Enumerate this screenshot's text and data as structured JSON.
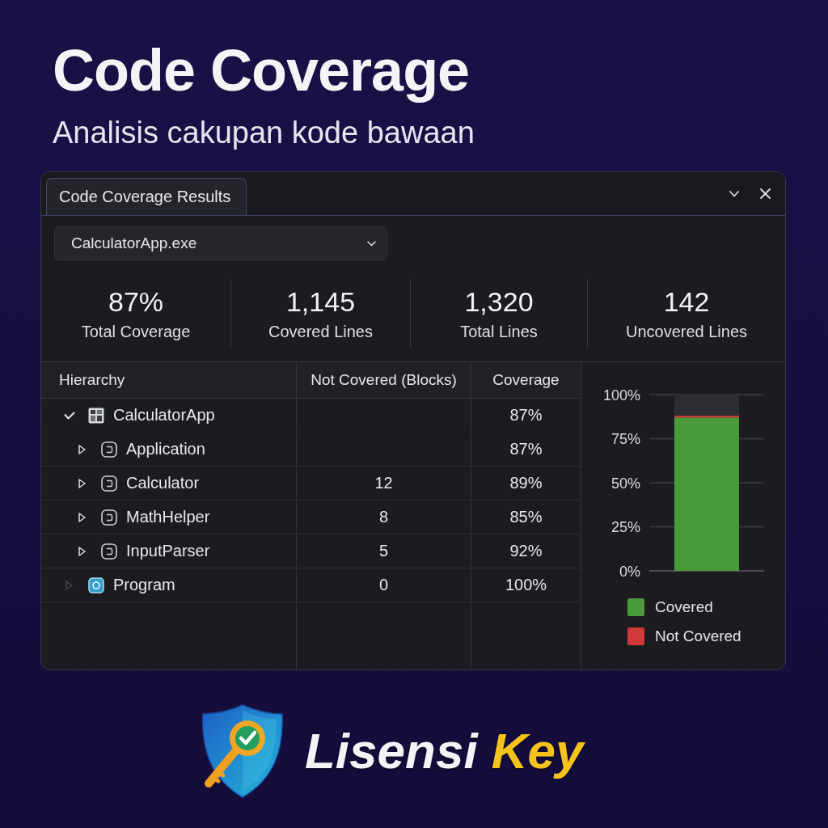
{
  "header": {
    "title": "Code Coverage",
    "subtitle": "Analisis cakupan kode bawaan"
  },
  "window": {
    "tabs": [
      {
        "label": "Code Coverage Results",
        "selected": true
      }
    ],
    "target_selector": {
      "value": "CalculatorApp.exe"
    },
    "stats": [
      {
        "value": "87%",
        "label": "Total Coverage"
      },
      {
        "value": "1,145",
        "label": "Covered Lines"
      },
      {
        "value": "1,320",
        "label": "Total Lines"
      },
      {
        "value": "142",
        "label": "Uncovered Lines"
      }
    ],
    "table": {
      "columns": [
        "Hierarchy",
        "Not Covered (Blocks)",
        "Coverage"
      ],
      "rows": [
        {
          "name": "CalculatorApp",
          "kind": "project",
          "expandable": true,
          "expanded": true,
          "coverage": "87%",
          "children": [
            {
              "name": "Application",
              "kind": "class",
              "expandable": true,
              "expanded": false,
              "coverage": "87%"
            },
            {
              "name": "Calculator",
              "kind": "class",
              "expandable": true,
              "expanded": false,
              "not_covered": "12",
              "coverage": "89%"
            },
            {
              "name": "MathHelper",
              "kind": "class",
              "expandable": true,
              "expanded": false,
              "not_covered": "8",
              "coverage": "85%"
            },
            {
              "name": "InputParser",
              "kind": "class",
              "expandable": true,
              "expanded": false,
              "not_covered": "5",
              "coverage": "92%"
            }
          ]
        },
        {
          "name": "Program",
          "kind": "program",
          "expandable": false,
          "expanded": false,
          "not_covered": "0",
          "coverage": "100%"
        }
      ]
    },
    "chart": {
      "chart_data": {
        "type": "bar",
        "stacked": true,
        "grid": true,
        "ylim": [
          0,
          100
        ],
        "yticks": [
          {
            "value": 0,
            "label": "0%"
          },
          {
            "value": 25,
            "label": "25%"
          },
          {
            "value": 50,
            "label": "50%"
          },
          {
            "value": 75,
            "label": "75%"
          },
          {
            "value": 100,
            "label": "100%"
          }
        ],
        "series": [
          {
            "name": "Covered",
            "color": "#4a9a3c",
            "values": [
              87
            ]
          },
          {
            "name": "Not Covered",
            "color": "#d13a3a",
            "values": [
              1
            ]
          }
        ]
      }
    }
  },
  "logo": {
    "words": [
      {
        "text": "Lisensi",
        "color": "#f4f4f6"
      },
      {
        "text": "Key",
        "color": "#f6c21c"
      }
    ]
  }
}
